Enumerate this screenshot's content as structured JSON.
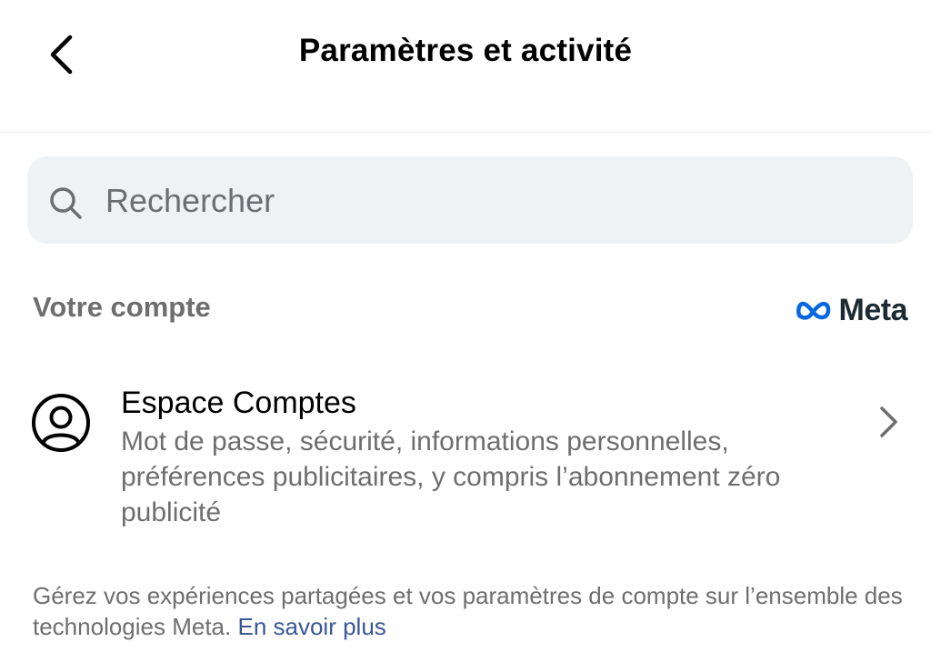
{
  "header": {
    "back_icon": "chevron-left-icon",
    "title": "Paramètres et activité"
  },
  "search": {
    "icon": "search-icon",
    "placeholder": "Rechercher",
    "value": ""
  },
  "account_section": {
    "title": "Votre compte",
    "brand": {
      "logo_icon": "meta-infinity-icon",
      "label": "Meta",
      "logo_color": "#0668E1"
    },
    "items": [
      {
        "icon": "user-circle-icon",
        "title": "Espace Comptes",
        "description": "Mot de passe, sécurité, informations personnelles, préférences publicitaires, y compris l’abonnement zéro publicité",
        "chevron_icon": "chevron-right-icon"
      }
    ]
  },
  "footer": {
    "note": "Gérez vos expériences partagées et vos paramètres de compte sur l’ensemble des technologies Meta.",
    "link_label": "En savoir plus",
    "link_color": "#385898"
  }
}
